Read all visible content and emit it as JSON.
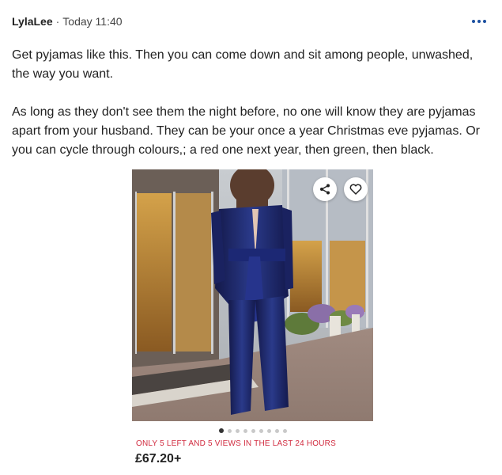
{
  "post": {
    "author": "LylaLee",
    "separator": "·",
    "timestamp": "Today 11:40",
    "paragraphs": [
      "Get pyjamas like this. Then you can come down and sit among people, unwashed, the way you want.",
      "As long as they don't see them the night before, no one will know they are pyjamas apart from your husband. They can be your once a year Christmas eve pyjamas. Or you can cycle through colours,; a red one next year, then green, then black."
    ]
  },
  "product": {
    "image_icons": [
      "share-icon",
      "heart-icon"
    ],
    "carousel": {
      "total": 9,
      "active": 1
    },
    "stock_notice": "ONLY 5 LEFT AND 5 VIEWS IN THE LAST 24 HOURS",
    "price": "£67.20+"
  },
  "colors": {
    "accent": "#1b4fa0",
    "stock_notice": "#d12b3f",
    "garment": "#1e2a66"
  }
}
